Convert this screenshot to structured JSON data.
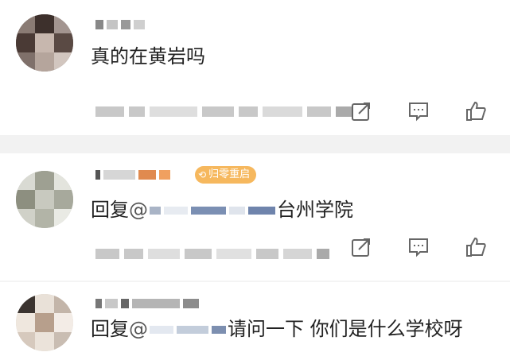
{
  "comments": [
    {
      "text": "真的在黄岩吗"
    },
    {
      "reply_prefix": "回复",
      "at": "@",
      "text": "台州学院",
      "badge": "归零重启"
    },
    {
      "reply_prefix": "回复",
      "at": "@",
      "text": "请问一下 你们是什么学校呀"
    }
  ],
  "actions": {
    "share_icon": "share-icon",
    "comment_icon": "comment-icon",
    "like_icon": "thumbs-up-icon"
  },
  "colors": {
    "badge": "#f6b85e",
    "divider": "#f2f2f2",
    "icon": "#666666"
  }
}
